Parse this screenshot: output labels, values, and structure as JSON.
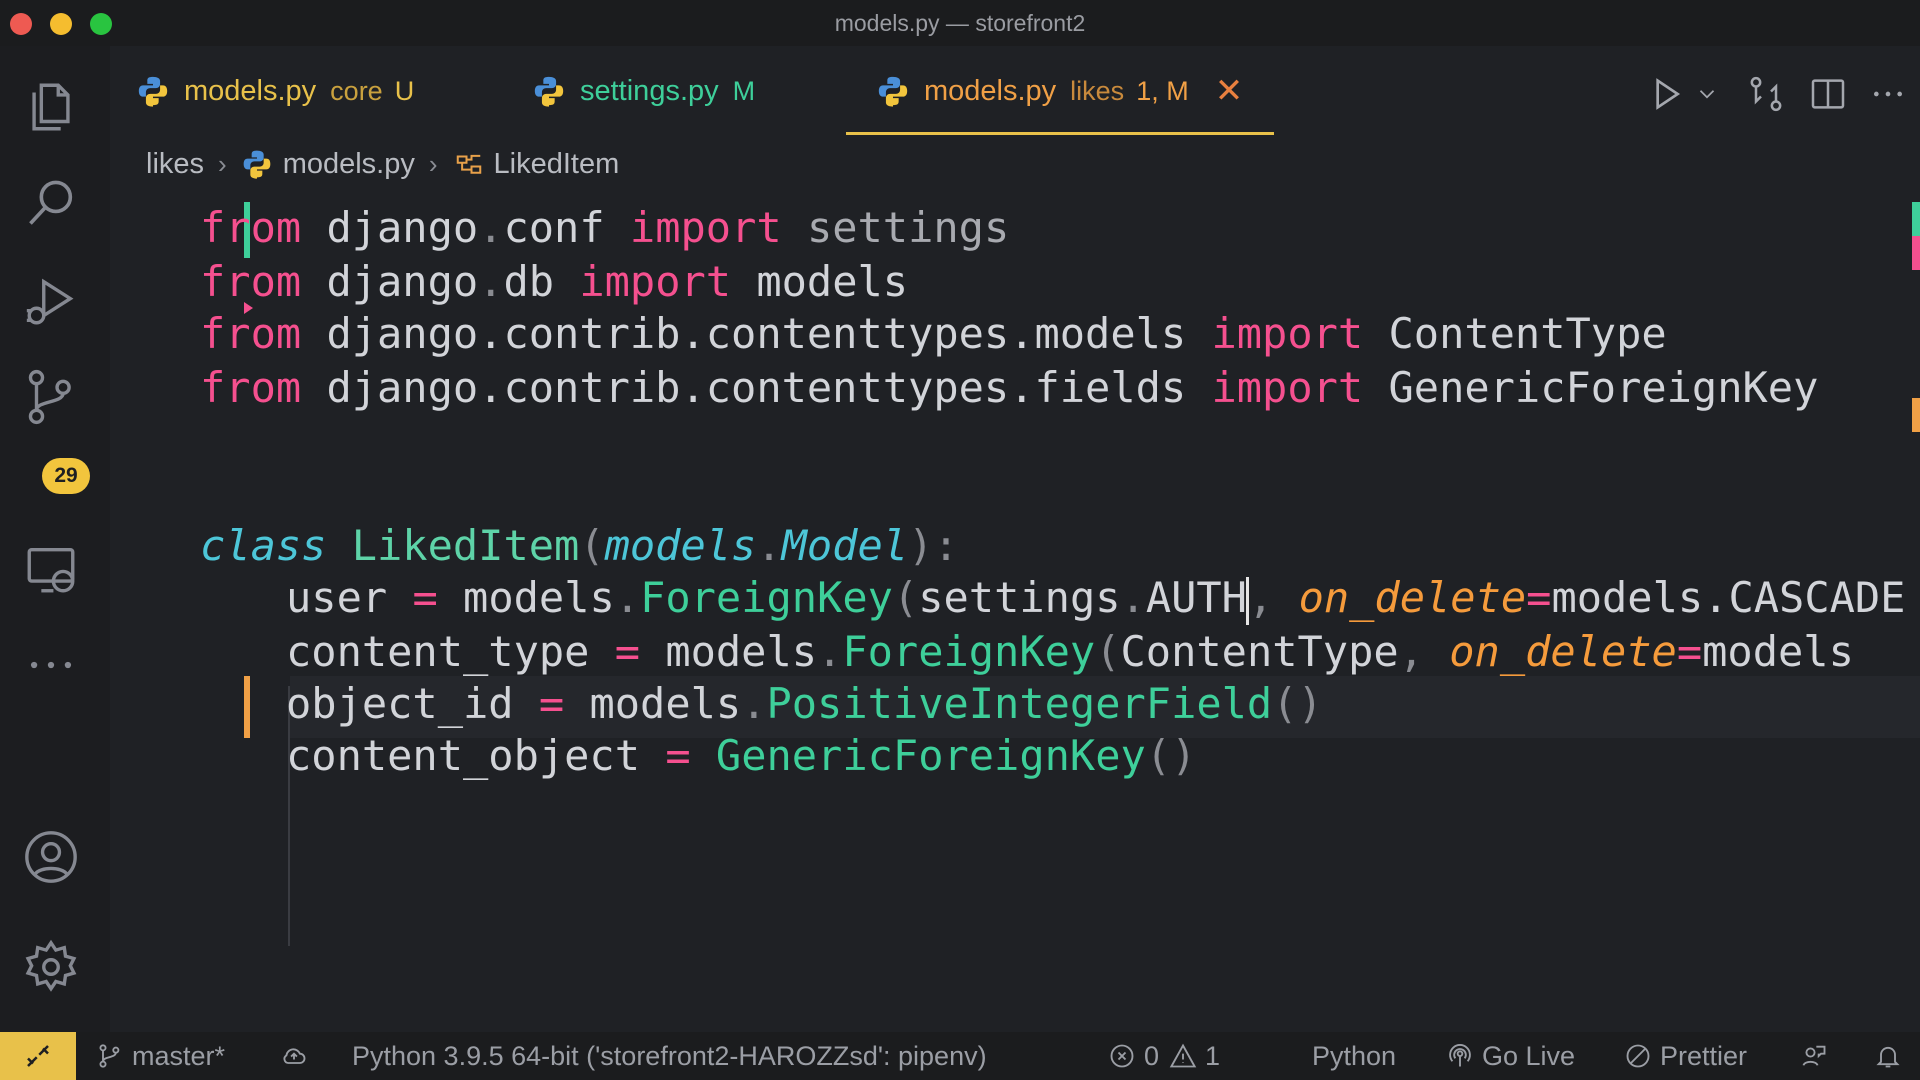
{
  "window": {
    "title": "models.py — storefront2"
  },
  "activity_bar": {
    "scm_badge": "29"
  },
  "tabs": [
    {
      "name": "models.py",
      "sub": "core",
      "status": "U",
      "name_color": "#e8c14a",
      "sub_color": "#c9a13e",
      "status_color": "#e8c14a"
    },
    {
      "name": "settings.py",
      "sub": "",
      "status": "M",
      "name_color": "#3ecf9a",
      "sub_color": "#3ecf9a",
      "status_color": "#3ecf9a"
    },
    {
      "name": "models.py",
      "sub": "likes",
      "status": "1, M",
      "name_color": "#f0a046",
      "sub_color": "#c98a3c",
      "status_color": "#f0a046"
    }
  ],
  "breadcrumb": {
    "folder": "likes",
    "file": "models.py",
    "symbol": "LikedItem"
  },
  "code": {
    "l1": {
      "from": "from",
      "mod1": "django",
      "dot": ".",
      "mod2": "conf",
      "imp": "import",
      "name": "settings"
    },
    "l2": {
      "from": "from",
      "mod1": "django",
      "dot": ".",
      "mod2": "db",
      "imp": "import",
      "name": "models"
    },
    "l3": {
      "from": "from",
      "mod": "django.contrib.contenttypes.models",
      "imp": "import",
      "name": "ContentType"
    },
    "l4": {
      "from": "from",
      "mod": "django.contrib.contenttypes.fields",
      "imp": "import",
      "name": "GenericForeignKey"
    },
    "l7": {
      "class": "class",
      "name": "LikedItem",
      "base1": "models",
      "base2": "Model"
    },
    "l8": {
      "var": "user",
      "eq": "=",
      "obj": "models",
      "fn": "ForeignKey",
      "arg1a": "settings",
      "arg1b": "AUTH",
      "kw": "on_delete",
      "val": "models.CASCADE"
    },
    "l9": {
      "var": "content_type",
      "eq": "=",
      "obj": "models",
      "fn": "ForeignKey",
      "arg1": "ContentType",
      "kw": "on_delete",
      "val": "models"
    },
    "l10": {
      "var": "object_id",
      "eq": "=",
      "obj": "models",
      "fn": "PositiveIntegerField"
    },
    "l11": {
      "var": "content_object",
      "eq": "=",
      "fn": "GenericForeignKey"
    }
  },
  "status_bar": {
    "branch": "master*",
    "interpreter": "Python 3.9.5 64-bit ('storefront2-HAROZZsd': pipenv)",
    "errors": "0",
    "warnings": "1",
    "language": "Python",
    "go_live": "Go Live",
    "prettier": "Prettier"
  }
}
